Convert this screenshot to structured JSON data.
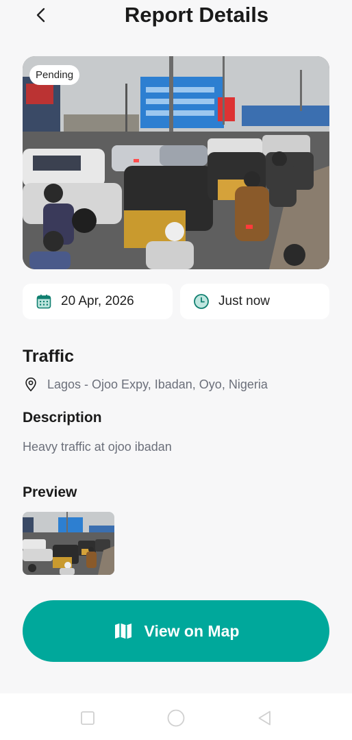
{
  "header": {
    "title": "Report Details"
  },
  "report": {
    "status": "Pending",
    "date": "20 Apr, 2026",
    "time": "Just now",
    "category": "Traffic",
    "location": "Lagos - Ojoo Expy, Ibadan, Oyo, Nigeria",
    "description_heading": "Description",
    "description": "Heavy traffic at ojoo ibadan",
    "preview_heading": "Preview"
  },
  "actions": {
    "view_on_map": "View on Map"
  },
  "icons": {
    "back": "chevron-left-icon",
    "calendar": "calendar-icon",
    "clock": "clock-icon",
    "location": "location-pin-icon",
    "map": "map-icon",
    "nav_recent": "square-icon",
    "nav_home": "circle-icon",
    "nav_back": "triangle-back-icon"
  },
  "colors": {
    "accent": "#00a89b",
    "chip_icon": "#0f7f6f",
    "muted_text": "#6b6f7a",
    "background": "#f7f7f8"
  }
}
